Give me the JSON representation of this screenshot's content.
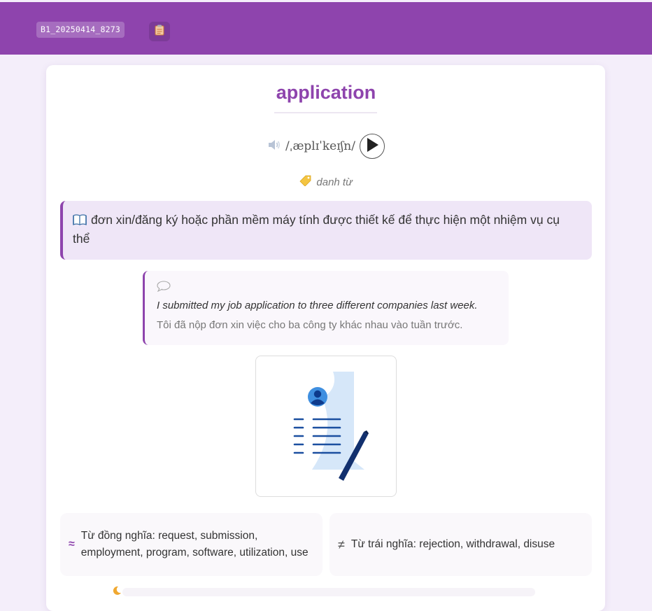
{
  "header": {
    "code": "B1_20250414_8273",
    "copy_icon": "clipboard-icon",
    "bg_color": "#8e44ad"
  },
  "word": {
    "text": "application",
    "ipa": "/ˌæplɪˈkeɪʃn/",
    "speaker_icon": "speaker-icon",
    "play_icon": "play-icon",
    "pos_icon": "tag-icon",
    "pos": "danh từ"
  },
  "definition": {
    "icon": "book-icon",
    "text": "đơn xin/đăng ký hoặc phần mềm máy tính được thiết kế để thực hiện một nhiệm vụ cụ thể"
  },
  "example": {
    "icon": "speech-bubble-icon",
    "en": "I submitted my job application to three different companies last week.",
    "vi": "Tôi đã nộp đơn xin việc cho ba công ty khác nhau vào tuần trước."
  },
  "illustration": {
    "icon": "job-application-document-icon"
  },
  "relations": {
    "synonyms": {
      "symbol": "≈",
      "text": "Từ đồng nghĩa: request, submission, employment, program, software, utilization, use"
    },
    "antonyms": {
      "symbol": "≠",
      "text": "Từ trái nghĩa: rejection, withdrawal, disuse"
    }
  }
}
